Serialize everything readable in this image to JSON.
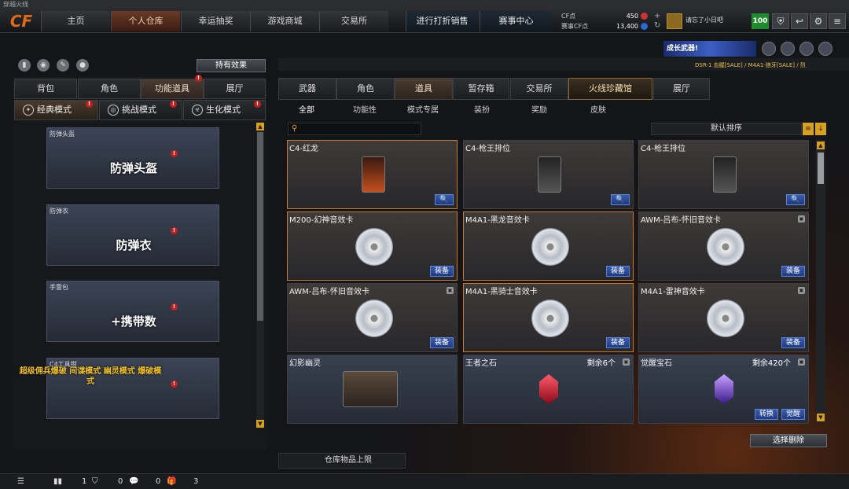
{
  "window_title": "穿越火线",
  "logo": "CF",
  "nav": {
    "items": [
      "主页",
      "个人仓库",
      "幸运抽奖",
      "游戏商城",
      "交易所",
      "进行打折销售",
      "赛事中心"
    ]
  },
  "currency": {
    "cf_label": "CF点",
    "cf_value": "450",
    "cf_icon": "cf-coin-icon",
    "card_label": "赛事CF点",
    "card_value": "13,400",
    "card_icon": "event-coin-icon"
  },
  "user": {
    "name": "请忘了小日吧",
    "level": "100"
  },
  "top_buttons": {
    "shield": "shield-icon",
    "back": "exit-icon",
    "settings": "gear-icon",
    "menu": "menu-icon"
  },
  "left": {
    "hold_effect": "持有效果",
    "tabs": [
      "背包",
      "角色",
      "功能道具",
      "展厅"
    ],
    "modes": [
      "经典模式",
      "挑战模式",
      "生化模式"
    ],
    "cards": [
      {
        "label": "防弹头盔",
        "big": "防弹头盔"
      },
      {
        "label": "防弹衣",
        "big": "防弹衣"
      },
      {
        "label": "手雷包",
        "big": "+携带数"
      },
      {
        "label": "C4工具钳",
        "big": "超级佣兵爆破 间谍模式 幽灵模式 爆破模式"
      }
    ]
  },
  "banner": {
    "text": "成长武器!",
    "ticker": "DSR-1 血腥[SALE] / M4A1-狼牙[SALE] / 烈"
  },
  "right": {
    "tabs": [
      "武器",
      "角色",
      "道具",
      "暂存箱",
      "交易所",
      "火线珍藏馆",
      "展厅"
    ],
    "subtabs": [
      "全部",
      "功能性",
      "模式专属",
      "装扮",
      "奖励",
      "皮肤"
    ],
    "sort": "默认排序",
    "items": [
      {
        "name": "C4-红龙",
        "action": "🔍",
        "kind": "c4"
      },
      {
        "name": "C4-枪王排位",
        "action": "🔍",
        "kind": "c4"
      },
      {
        "name": "C4-枪王排位",
        "action": "🔍",
        "kind": "c4"
      },
      {
        "name": "M200-幻神音效卡",
        "action": "装备",
        "kind": "disc"
      },
      {
        "name": "M4A1-黑龙音效卡",
        "action": "装备",
        "kind": "disc"
      },
      {
        "name": "AWM-吕布-怀旧音效卡",
        "action": "装备",
        "kind": "disc"
      },
      {
        "name": "AWM-吕布-怀旧音效卡",
        "action": "装备",
        "kind": "disc"
      },
      {
        "name": "M4A1-黑骑士音效卡",
        "action": "装备",
        "kind": "disc"
      },
      {
        "name": "M4A1-雷神音效卡",
        "action": "装备",
        "kind": "disc"
      },
      {
        "name": "幻影幽灵",
        "action": "",
        "kind": "char"
      },
      {
        "name": "王者之石",
        "count": "剩余6个",
        "action": "",
        "kind": "gem-red"
      },
      {
        "name": "觉醒宝石",
        "count": "剩余420个",
        "action": "觉醒",
        "action2": "转换",
        "kind": "gem-purple"
      }
    ],
    "delete_btn": "选择删除",
    "capacity": "仓库物品上限"
  },
  "bottom": {
    "v1": "1",
    "v2": "0",
    "v3": "0",
    "v4": "3"
  }
}
